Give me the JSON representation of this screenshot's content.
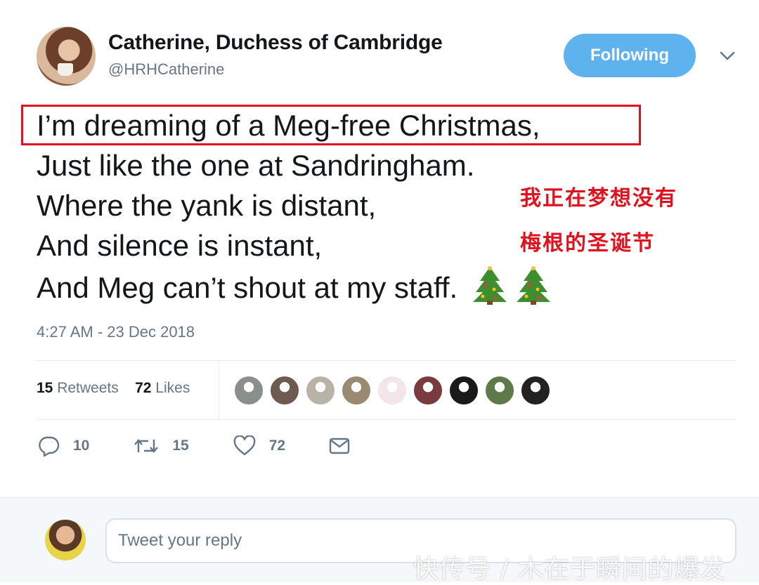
{
  "tweet": {
    "author_name": "Catherine, Duchess of Cambridge",
    "handle": "@HRHCatherine",
    "follow_label": "Following",
    "lines": [
      "I’m dreaming of a Meg-free Christmas,",
      "Just like the one at Sandringham.",
      "Where the yank is distant,",
      "And silence is instant,",
      "And Meg can’t shout at my staff."
    ],
    "timestamp": "4:27 AM - 23 Dec 2018"
  },
  "annotation": {
    "line1": "我正在梦想没有",
    "line2": "梅根的圣诞节",
    "color": "#e0121f"
  },
  "stats": {
    "retweets_count": "15",
    "retweets_label": "Retweets",
    "likes_count": "72",
    "likes_label": "Likes",
    "liker_avatars": [
      "#8a8f8c",
      "#6e5a4e",
      "#b9b2a6",
      "#9a8a72",
      "#f3e6ea",
      "#7a3b3f",
      "#1a1a1a",
      "#5f7a4a",
      "#222222"
    ]
  },
  "actions": {
    "reply_count": "10",
    "retweet_count": "15",
    "like_count": "72"
  },
  "reply": {
    "placeholder": "Tweet your reply"
  },
  "watermark": "快传号 / 木在于瞬间的爆发",
  "colors": {
    "accent": "#5eb2ee",
    "text": "#14171a",
    "muted": "#657786"
  }
}
